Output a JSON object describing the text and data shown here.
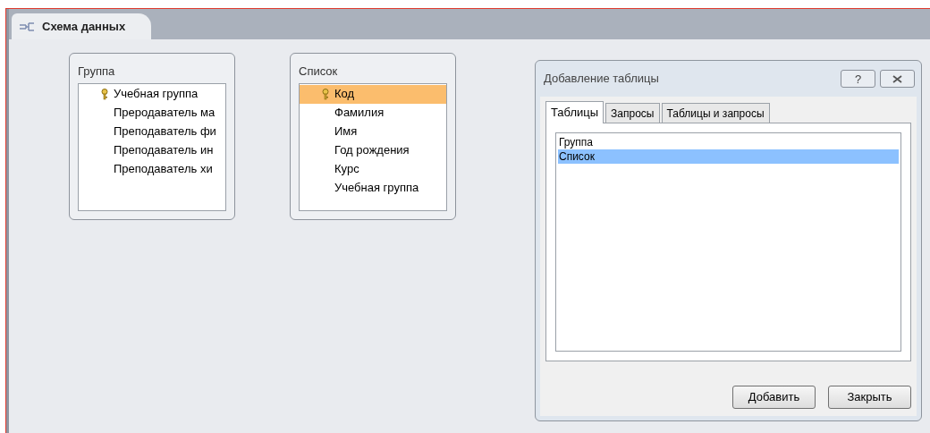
{
  "document_tab": {
    "label": "Схема данных",
    "selected": true
  },
  "tables": [
    {
      "title": "Группа",
      "fields": [
        {
          "name": "Учебная группа",
          "key": true,
          "selected": false
        },
        {
          "name": "Преродаватель ма",
          "key": false,
          "selected": false
        },
        {
          "name": "Преподаватель фи",
          "key": false,
          "selected": false
        },
        {
          "name": "Преподаватель ин",
          "key": false,
          "selected": false
        },
        {
          "name": "Преподаватель хи",
          "key": false,
          "selected": false
        }
      ]
    },
    {
      "title": "Список",
      "fields": [
        {
          "name": "Код",
          "key": true,
          "selected": true
        },
        {
          "name": "Фамилия",
          "key": false,
          "selected": false
        },
        {
          "name": "Имя",
          "key": false,
          "selected": false
        },
        {
          "name": "Год рождения",
          "key": false,
          "selected": false
        },
        {
          "name": "Курс",
          "key": false,
          "selected": false
        },
        {
          "name": "Учебная группа",
          "key": false,
          "selected": false
        }
      ]
    }
  ],
  "dialog": {
    "title": "Добавление таблицы",
    "help": "?",
    "tabs": [
      {
        "label": "Таблицы",
        "selected": true
      },
      {
        "label": "Запросы",
        "selected": false
      },
      {
        "label": "Таблицы и запросы",
        "selected": false
      }
    ],
    "items": [
      {
        "label": "Группа",
        "selected": false
      },
      {
        "label": "Список",
        "selected": true
      }
    ],
    "buttons": [
      "Добавить",
      "Закрыть"
    ]
  }
}
